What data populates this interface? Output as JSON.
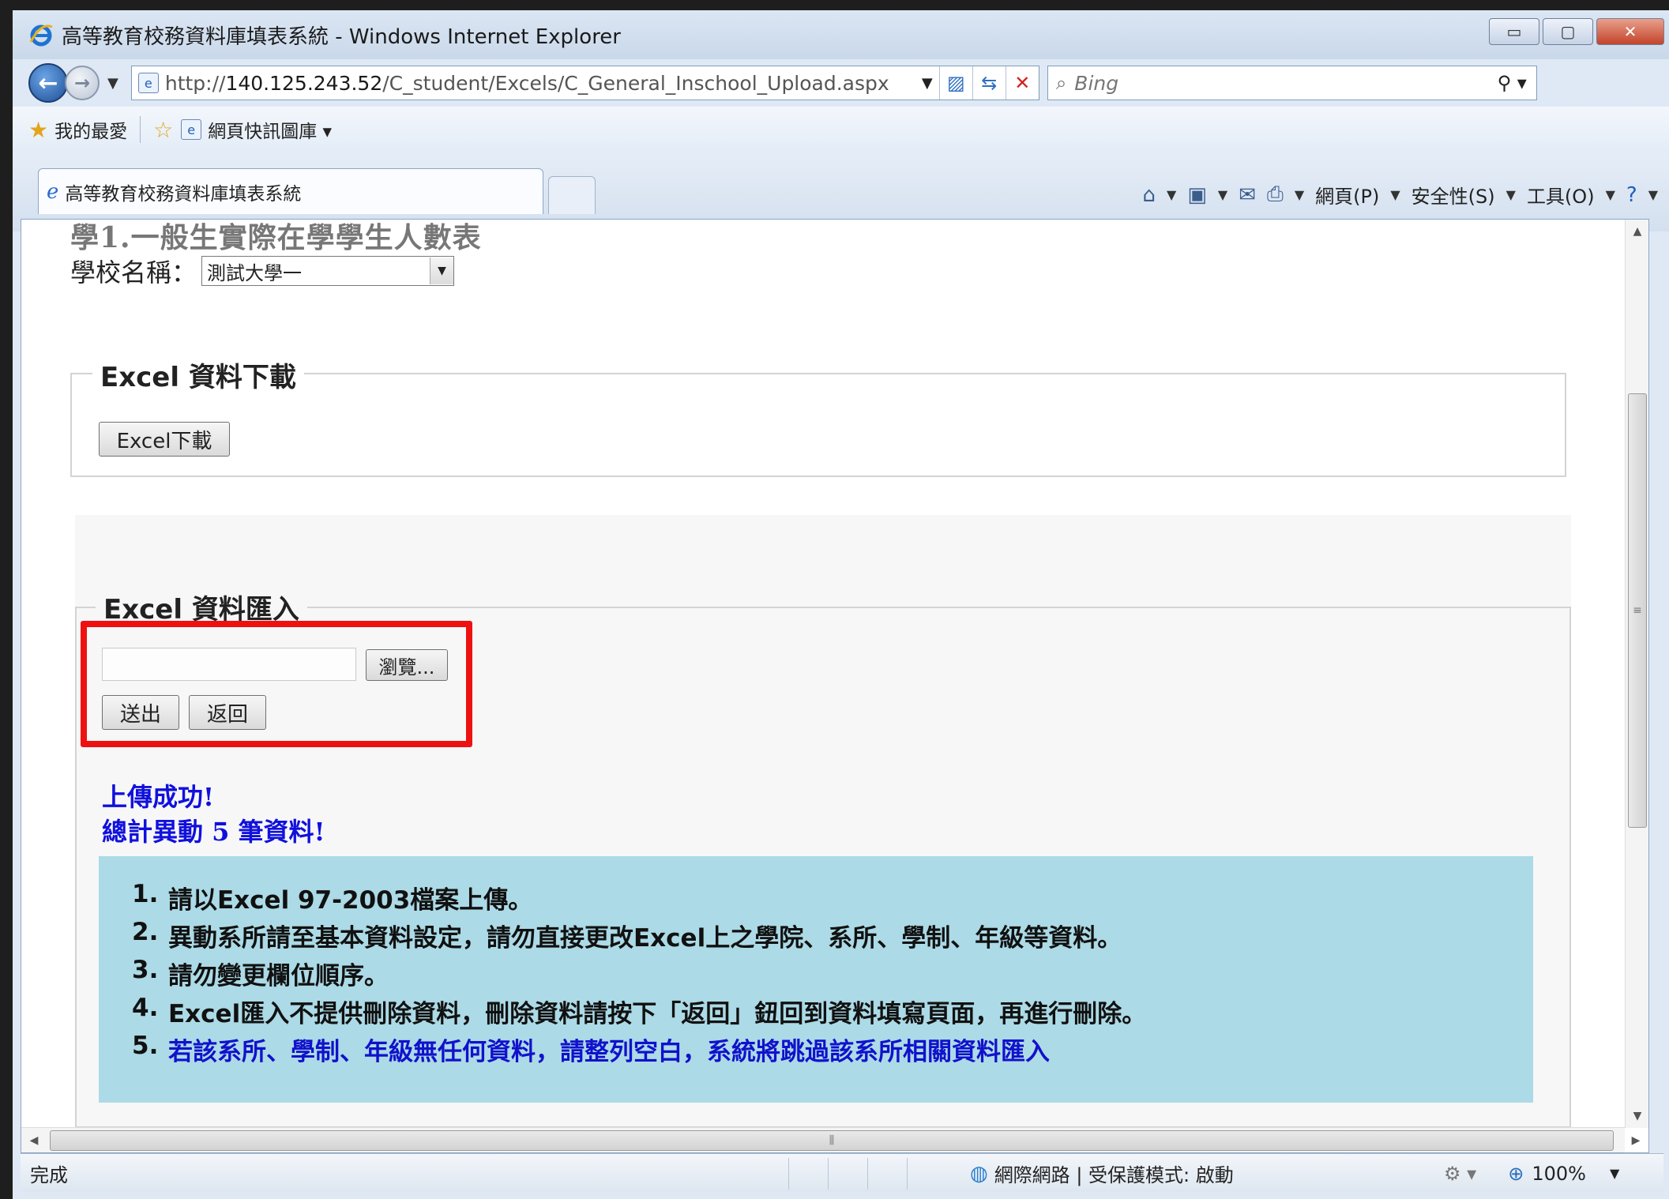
{
  "window": {
    "title": "高等教育校務資料庫填表系統 - Windows Internet Explorer",
    "minimize": "▭",
    "maximize": "▢",
    "close": "✕"
  },
  "address": {
    "url_prefix": "http://",
    "url_host": "140.125.243.52",
    "url_path": "/C_student/Excels/C_General_Inschool_Upload.aspx",
    "search_placeholder": "Bing"
  },
  "favorites": {
    "favorites_label": "我的最愛",
    "web_slice_label": "網頁快訊圖庫 ▾"
  },
  "tab": {
    "label": "高等教育校務資料庫填表系統"
  },
  "commandbar": {
    "page_menu": "網頁(P)",
    "safety_menu": "安全性(S)",
    "tools_menu": "工具(O)"
  },
  "content": {
    "heading": "學1.一般生實際在學學生人數表",
    "school_label": "學校名稱：",
    "school_value": "測試大學一",
    "download_legend": "Excel 資料下載",
    "download_button": "Excel下載",
    "import_legend": "Excel 資料匯入",
    "browse_button": "瀏覽...",
    "send_button": "送出",
    "back_button": "返回",
    "success_msg": "上傳成功!",
    "count_msg": "總計異動 5 筆資料!",
    "notes": [
      {
        "num": "1.",
        "text": "請以Excel 97-2003檔案上傳。"
      },
      {
        "num": "2.",
        "text": "異動系所請至基本資料設定，請勿直接更改Excel上之學院、系所、學制、年級等資料。"
      },
      {
        "num": "3.",
        "text": "請勿變更欄位順序。"
      },
      {
        "num": "4.",
        "text": "Excel匯入不提供刪除資料，刪除資料請按下「返回」鈕回到資料填寫頁面，再進行刪除。"
      },
      {
        "num": "5.",
        "text": "若該系所、學制、年級無任何資料，請整列空白，系統將跳過該系所相關資料匯入"
      }
    ]
  },
  "status": {
    "left": "完成",
    "zone": "網際網路 | 受保護模式: 啟動",
    "zoom": "100%"
  },
  "icons": [
    "ie-logo-icon",
    "back-arrow-icon",
    "forward-arrow-icon",
    "page-icon",
    "compat-view-icon",
    "refresh-icon",
    "stop-icon",
    "search-icon",
    "star-icon",
    "add-favorite-icon",
    "home-icon",
    "feeds-icon",
    "mail-icon",
    "print-icon",
    "help-icon",
    "globe-icon",
    "zoom-icon"
  ]
}
